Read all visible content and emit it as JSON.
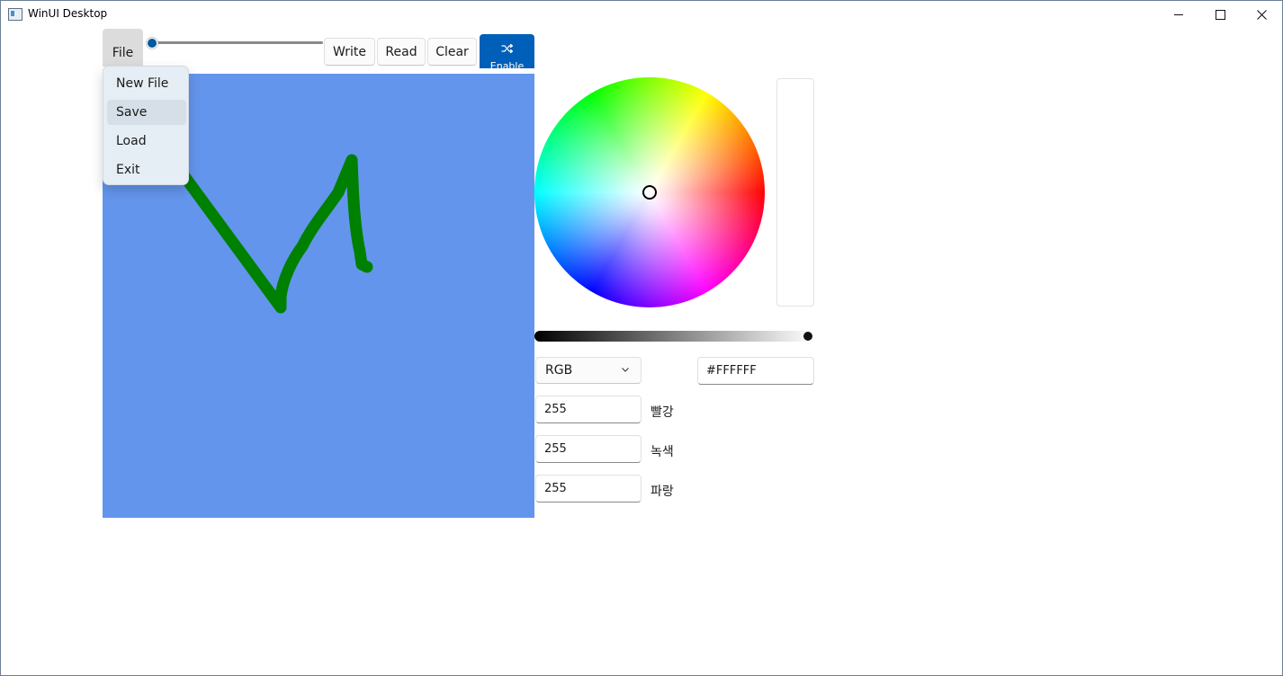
{
  "window": {
    "title": "WinUI Desktop",
    "controls": {
      "minimize": "minimize-icon",
      "maximize": "maximize-icon",
      "close": "close-icon"
    }
  },
  "menu": {
    "file_label": "File",
    "items": [
      {
        "label": "New File"
      },
      {
        "label": "Save",
        "hovered": true
      },
      {
        "label": "Load"
      },
      {
        "label": "Exit"
      }
    ]
  },
  "toolbar": {
    "stroke_size_fraction": 0.0,
    "write_label": "Write",
    "read_label": "Read",
    "clear_label": "Clear",
    "enable_label": "Enable",
    "enable_icon": "shuffle-icon"
  },
  "canvas": {
    "background": "#6495ED",
    "stroke_color": "#008000"
  },
  "color_picker": {
    "selected_hex": "#FFFFFF",
    "value_fraction": 1.0,
    "mode": "RGB",
    "channels": [
      {
        "value": "255",
        "label": "빨강"
      },
      {
        "value": "255",
        "label": "녹색"
      },
      {
        "value": "255",
        "label": "파랑"
      }
    ]
  }
}
